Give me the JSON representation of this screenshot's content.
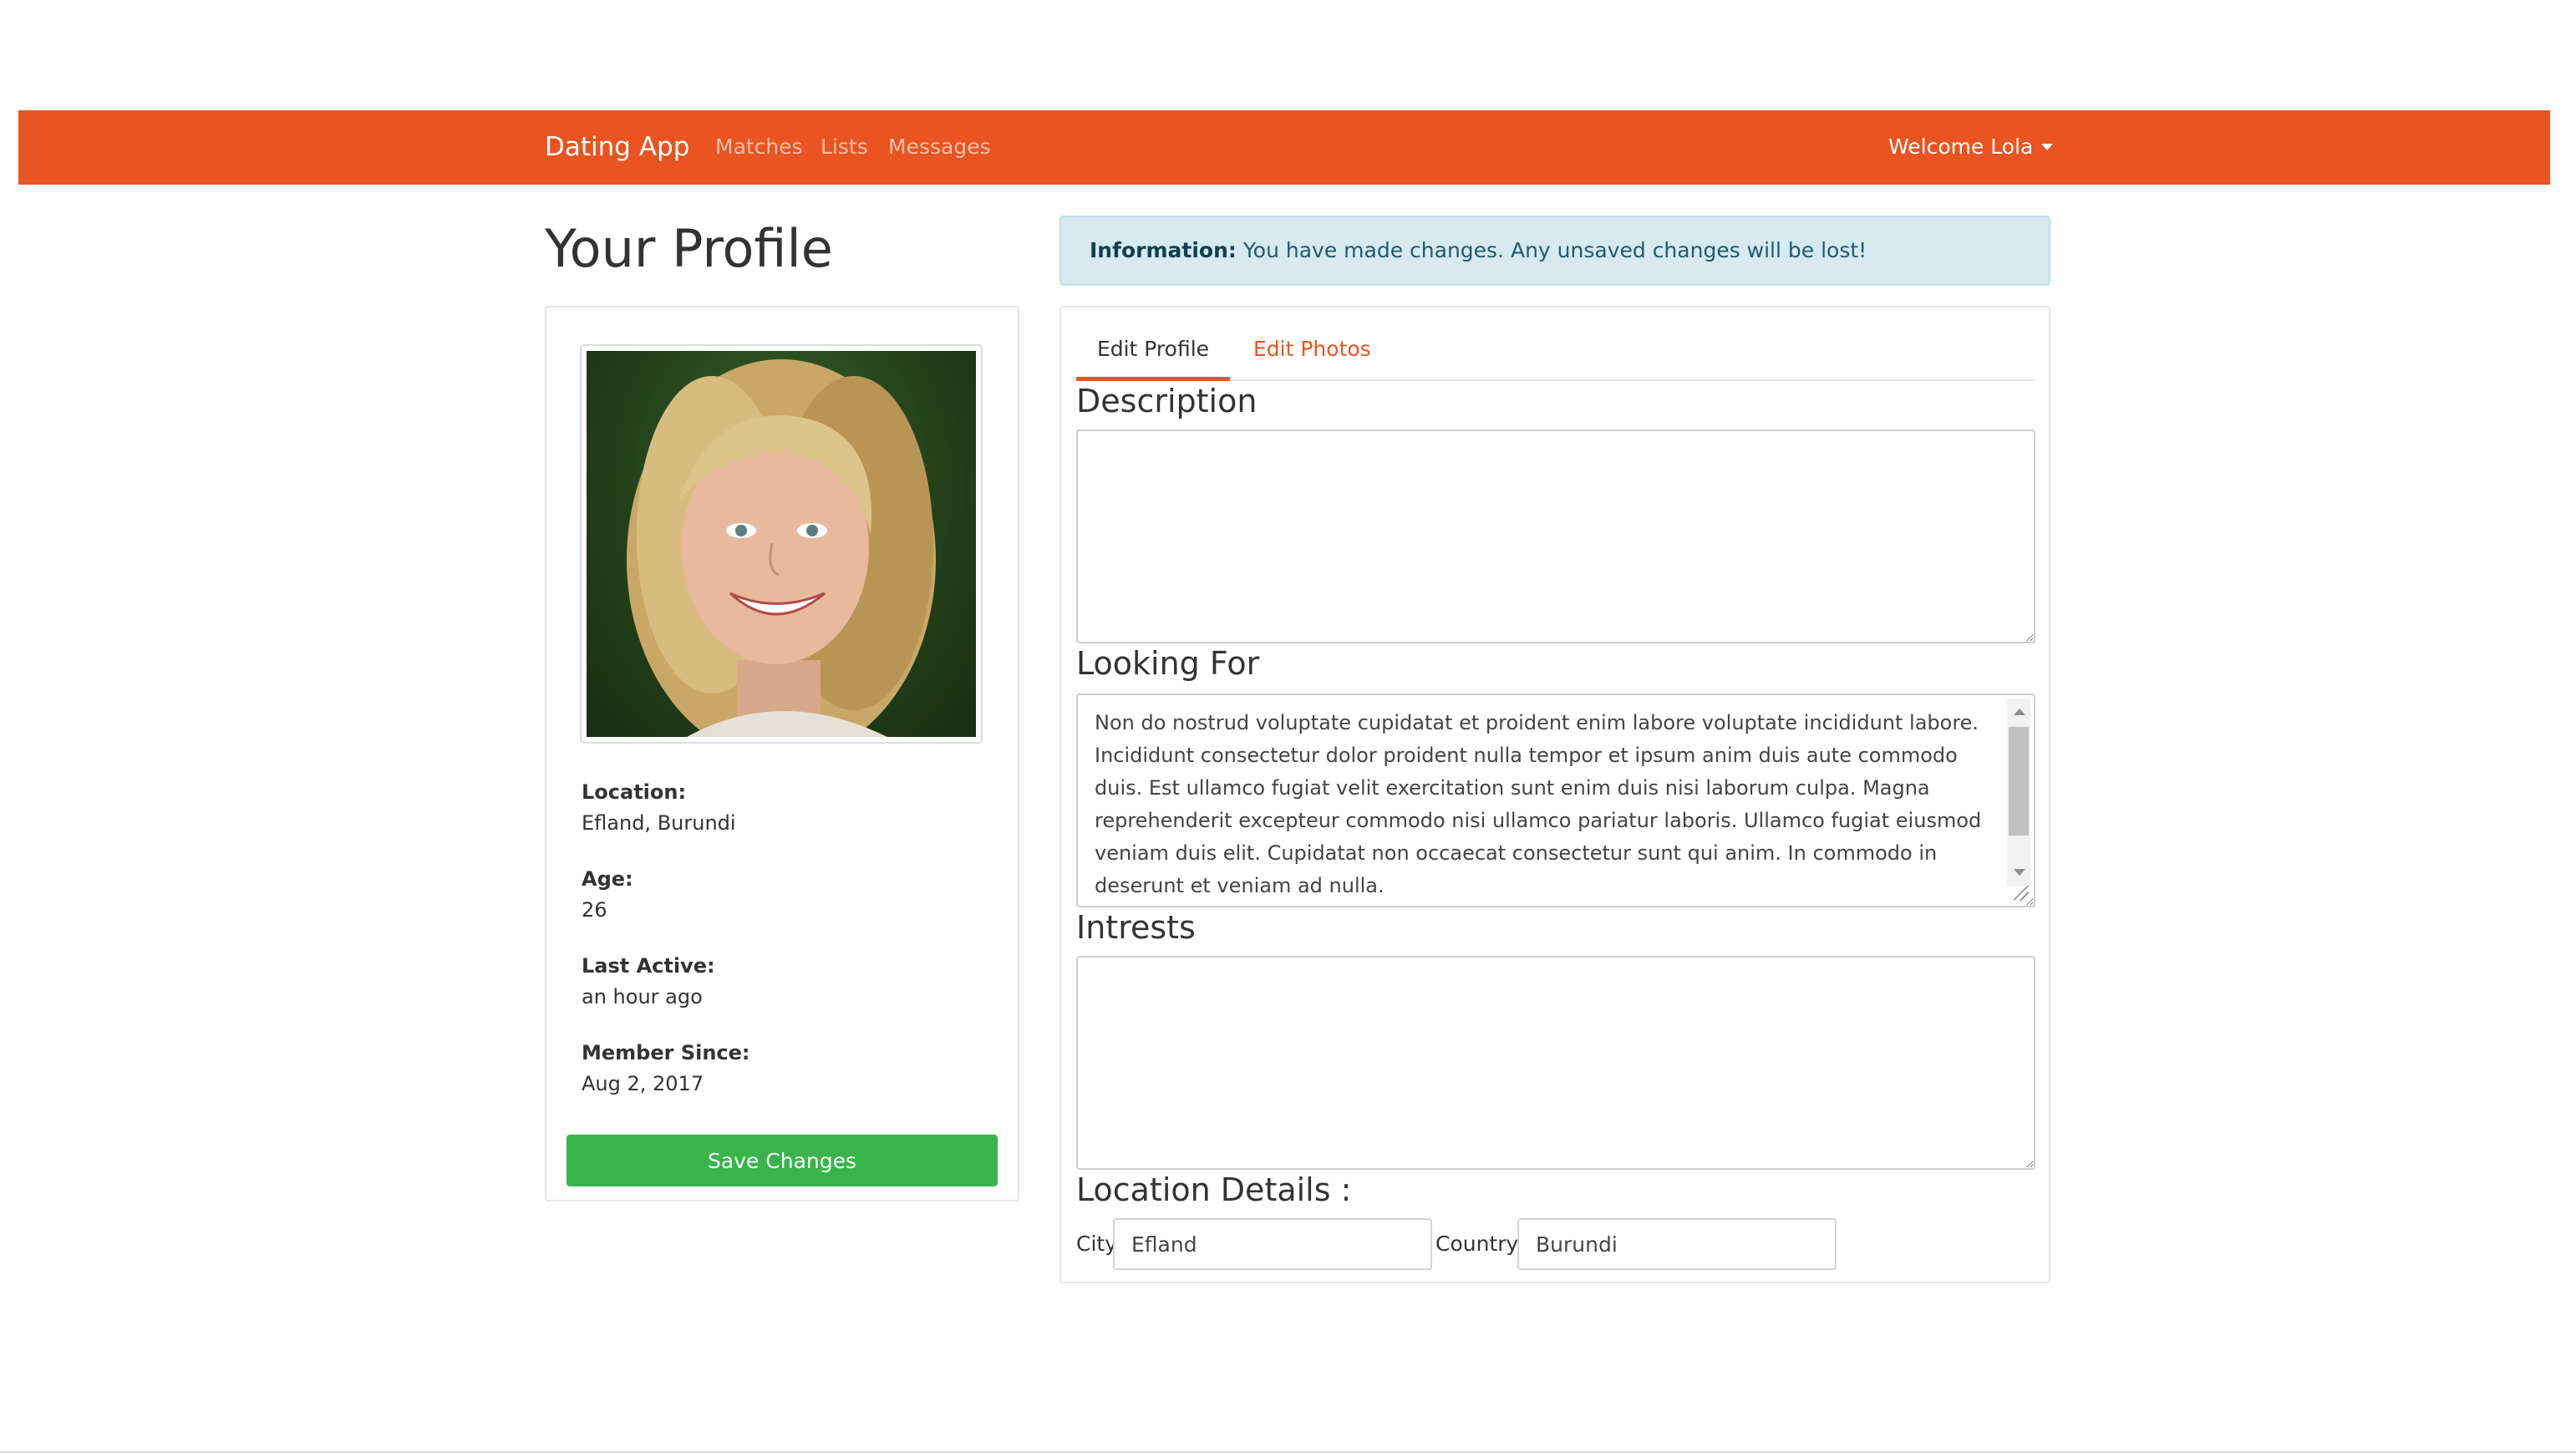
{
  "navbar": {
    "brand": "Dating App",
    "links": [
      "Matches",
      "Lists",
      "Messages"
    ],
    "welcome": "Welcome Lola",
    "color": "#e95420"
  },
  "page_title": "Your Profile",
  "profile": {
    "photo_alt": "profile-photo",
    "details": [
      {
        "label": "Location:",
        "value": "Efland, Burundi"
      },
      {
        "label": "Age:",
        "value": "26"
      },
      {
        "label": "Last Active:",
        "value": "an hour ago"
      },
      {
        "label": "Member Since:",
        "value": "Aug 2, 2017"
      }
    ],
    "save_label": "Save Changes",
    "save_color": "#38b44a"
  },
  "alert": {
    "label": "Information:",
    "text": "You have made changes. Any unsaved changes will be lost!"
  },
  "tabs": [
    "Edit Profile",
    "Edit Photos"
  ],
  "form": {
    "description_heading": "Description",
    "description_value": "",
    "looking_for_heading": "Looking For",
    "looking_for_value": "Non do nostrud voluptate cupidatat et proident enim labore voluptate incididunt labore. Incididunt consectetur dolor proident nulla tempor et ipsum anim duis aute commodo duis. Est ullamco fugiat velit exercitation sunt enim duis nisi laborum culpa. Magna reprehenderit excepteur commodo nisi ullamco pariatur laboris. Ullamco fugiat eiusmod veniam duis elit. Cupidatat non occaecat consectetur sunt qui anim. In commodo in deserunt et veniam ad nulla.",
    "interests_heading": "Intrests",
    "interests_value": "",
    "location_heading": "Location Details :",
    "city_label": "City",
    "city_value": "Efland",
    "country_label": "Country",
    "country_value": "Burundi"
  }
}
